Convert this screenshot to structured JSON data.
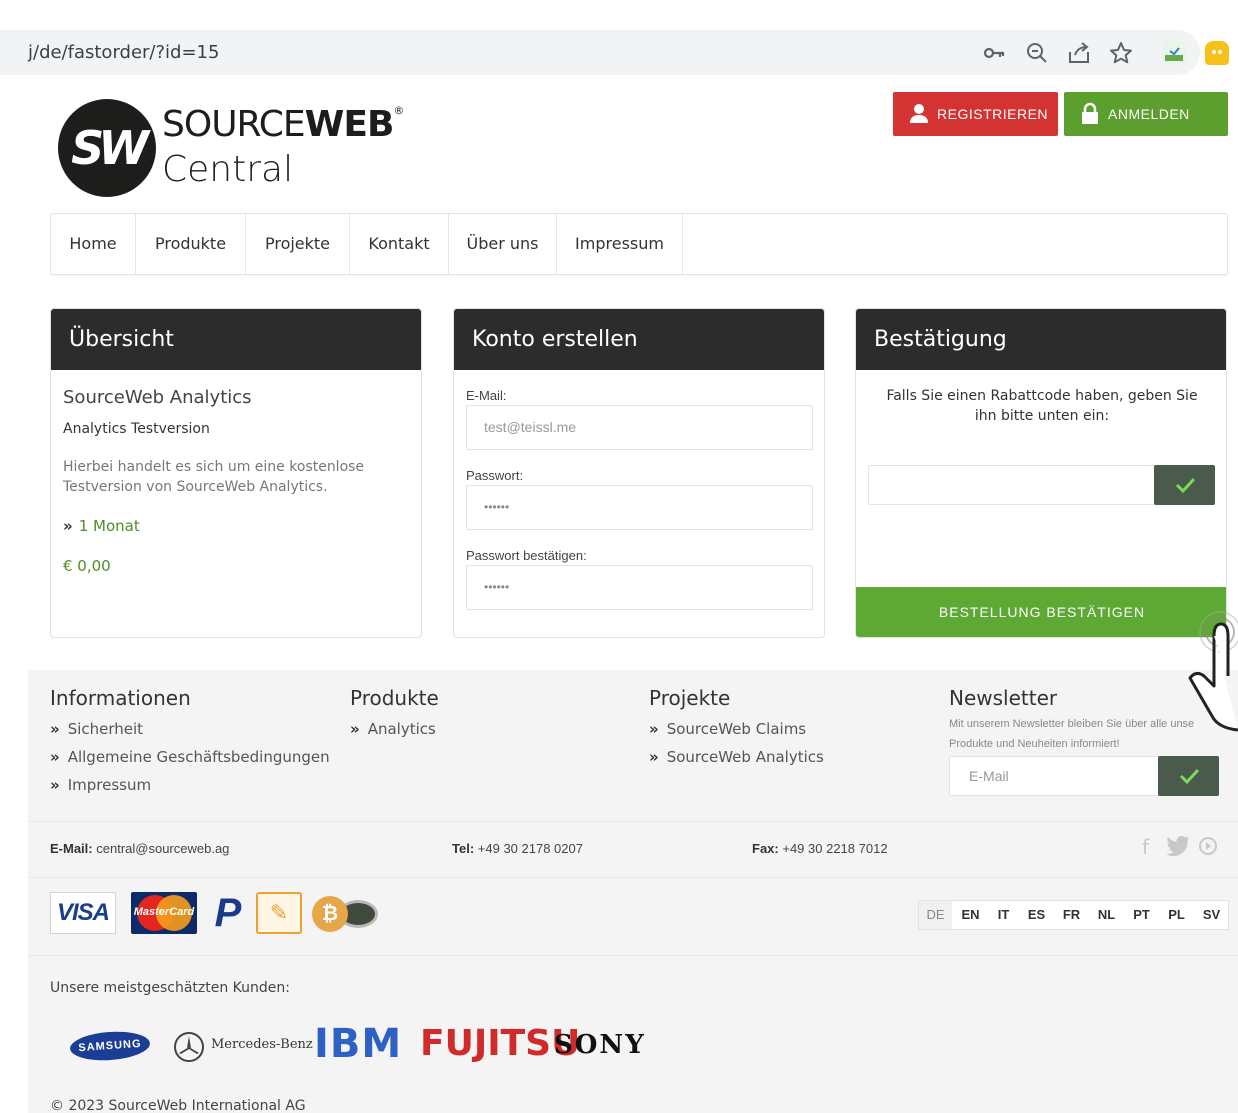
{
  "browser": {
    "url": "j/de/fastorder/?id=15",
    "icons": [
      "key-icon",
      "zoom-icon",
      "share-icon",
      "star-icon",
      "extension-icon",
      "profile-icon"
    ]
  },
  "header": {
    "logo_mark": "SW",
    "logo_word1": "SOURCE",
    "logo_word2": "WEB",
    "logo_reg": "®",
    "logo_sub": "Central",
    "register_label": "REGISTRIEREN",
    "login_label": "ANMELDEN"
  },
  "nav": {
    "items": [
      {
        "label": "Home"
      },
      {
        "label": "Produkte"
      },
      {
        "label": "Projekte"
      },
      {
        "label": "Kontakt"
      },
      {
        "label": "Über uns"
      },
      {
        "label": "Impressum"
      }
    ]
  },
  "overview": {
    "title": "Übersicht",
    "product": "SourceWeb Analytics",
    "variant": "Analytics Testversion",
    "description": "Hierbei handelt es sich um eine kostenlose Testversion von SourceWeb Analytics.",
    "duration_arrow": "»",
    "duration": "1 Monat",
    "price": "€ 0,00"
  },
  "account": {
    "title": "Konto erstellen",
    "email_label": "E-Mail:",
    "email_value": "test@teissl.me",
    "password_label": "Passwort:",
    "password_value": "••••••",
    "confirm_label": "Passwort bestätigen:",
    "confirm_value": "••••••"
  },
  "confirmation": {
    "title": "Bestätigung",
    "text": "Falls Sie einen Rabattcode haben, geben Sie ihn bitte unten ein:",
    "coupon_value": "",
    "confirm_button": "BESTELLUNG BESTÄTIGEN"
  },
  "footer": {
    "info": {
      "title": "Informationen",
      "links": [
        "Sicherheit",
        "Allgemeine Geschäftsbedingungen",
        "Impressum"
      ]
    },
    "products": {
      "title": "Produkte",
      "links": [
        "Analytics"
      ]
    },
    "projects": {
      "title": "Projekte",
      "links": [
        "SourceWeb Claims",
        "SourceWeb Analytics"
      ]
    },
    "newsletter": {
      "title": "Newsletter",
      "text": "Mit unserem Newsletter bleiben Sie über alle unse",
      "text2": "Produkte und Neuheiten informiert!",
      "placeholder": "E-Mail"
    },
    "contact": {
      "email_label": "E-Mail:",
      "email": "central@sourceweb.ag",
      "tel_label": "Tel:",
      "tel": "+49 30 2178 0207",
      "fax_label": "Fax:",
      "fax": "+49 30 2218 7012"
    },
    "payments": {
      "visa": "VISA",
      "mastercard": "MasterCard",
      "paypal": "P"
    },
    "languages": [
      "DE",
      "EN",
      "IT",
      "ES",
      "FR",
      "NL",
      "PT",
      "PL",
      "SV"
    ],
    "active_language": "DE",
    "customers_title": "Unsere meistgeschätzten Kunden:",
    "customers": {
      "samsung": "SAMSUNG",
      "mercedes": "Mercedes-Benz",
      "ibm": "IBM",
      "fujitsu": "FUJITSU",
      "sony": "SONY"
    },
    "copyright": "© 2023 SourceWeb International AG"
  },
  "colors": {
    "register": "#d43333",
    "login": "#5c9f2f",
    "confirm": "#5ea934",
    "accent_green": "#4e8f25",
    "panel_header": "#2c2c2c"
  }
}
